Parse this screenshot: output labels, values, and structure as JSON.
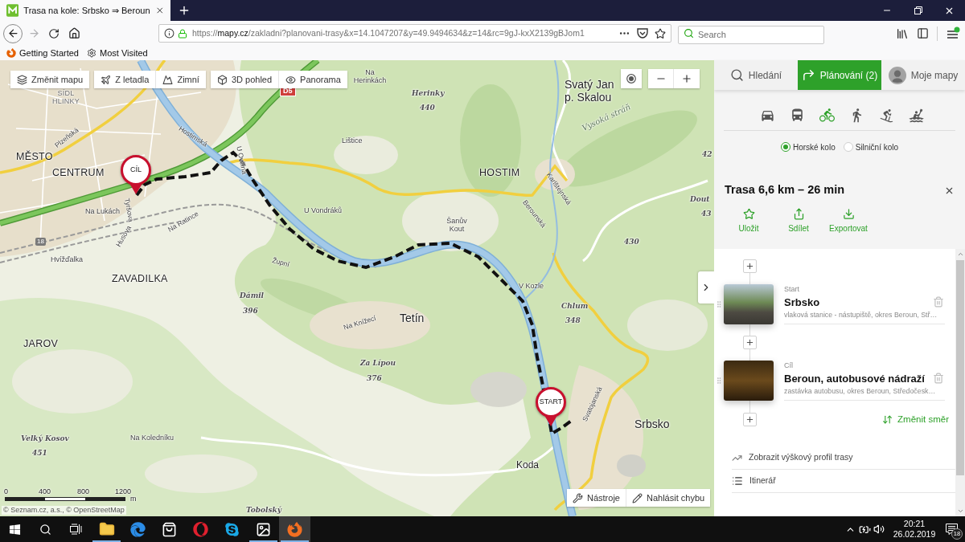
{
  "browser": {
    "tabs": [
      {
        "title": "Trasa na kole: Srbsko ⇒ Beroun",
        "selected": true
      }
    ],
    "address": {
      "scheme": "https://",
      "host": "mapy.cz",
      "path": "/zakladni?planovani-trasy&x=14.1047207&y=49.9494634&z=14&rc=9gJ-kxX2139gBJom1"
    },
    "search": {
      "placeholder": "Search"
    },
    "bookmarks": [
      {
        "label": "Getting Started",
        "kind": "firefox"
      },
      {
        "label": "Most Visited",
        "kind": "gear"
      }
    ]
  },
  "map": {
    "toolbar": [
      {
        "items": [
          {
            "label": "Změnit mapu",
            "kind": "layers"
          }
        ]
      },
      {
        "items": [
          {
            "label": "Z letadla",
            "kind": "plane"
          },
          {
            "label": "Zimní",
            "kind": "mountain"
          }
        ]
      },
      {
        "items": [
          {
            "label": "3D pohled",
            "kind": "cube"
          },
          {
            "label": "Panorama",
            "kind": "eye"
          }
        ]
      }
    ],
    "labels": [
      {
        "text": "Na Herinkách",
        "kind": "locality"
      },
      {
        "text": "SÍDL HLINKY",
        "kind": "district"
      },
      {
        "text": "D5",
        "kind": "highway"
      },
      {
        "text": "Herinky",
        "kind": "hill"
      },
      {
        "text": "Svatý Jan p. Skalou",
        "kind": "town"
      },
      {
        "text": "440",
        "kind": "elevation"
      },
      {
        "text": "Vysoká stráň",
        "kind": "area"
      },
      {
        "text": "Plzeňská",
        "kind": "street"
      },
      {
        "text": "Hostimská",
        "kind": "street"
      },
      {
        "text": "Lištice",
        "kind": "locality"
      },
      {
        "text": "MĚSTO",
        "kind": "city"
      },
      {
        "text": "U Ovčína",
        "kind": "street"
      },
      {
        "text": "42",
        "kind": "elevation"
      },
      {
        "text": "CENTRUM",
        "kind": "city"
      },
      {
        "text": "HOSTIM",
        "kind": "city"
      },
      {
        "text": "Karlštejnská",
        "kind": "street"
      },
      {
        "text": "Dout",
        "kind": "hill"
      },
      {
        "text": "Na Lukách",
        "kind": "locality"
      },
      {
        "text": "Tyršova",
        "kind": "street"
      },
      {
        "text": "Na Ratince",
        "kind": "street"
      },
      {
        "text": "U Vondráků",
        "kind": "locality"
      },
      {
        "text": "Berounská",
        "kind": "street"
      },
      {
        "text": "43",
        "kind": "elevation"
      },
      {
        "text": "Šanův Kout",
        "kind": "locality"
      },
      {
        "text": "18",
        "kind": "railway"
      },
      {
        "text": "Husova",
        "kind": "street"
      },
      {
        "text": "430",
        "kind": "elevation"
      },
      {
        "text": "Hvížďalka",
        "kind": "locality"
      },
      {
        "text": "Župní",
        "kind": "street"
      },
      {
        "text": "ZAVADILKA",
        "kind": "city"
      },
      {
        "text": "V Kozle",
        "kind": "locality"
      },
      {
        "text": "Dámil",
        "kind": "hill"
      },
      {
        "text": "396",
        "kind": "elevation"
      },
      {
        "text": "Chlum",
        "kind": "hill"
      },
      {
        "text": "Na Knížecí",
        "kind": "street"
      },
      {
        "text": "Tetín",
        "kind": "town"
      },
      {
        "text": "348",
        "kind": "elevation"
      },
      {
        "text": "JAROV",
        "kind": "city"
      },
      {
        "text": "Za Lípou",
        "kind": "hill"
      },
      {
        "text": "376",
        "kind": "elevation"
      },
      {
        "text": "Svatojanská",
        "kind": "street"
      },
      {
        "text": "Srbsko",
        "kind": "town"
      },
      {
        "text": "Velký Kosov",
        "kind": "hill"
      },
      {
        "text": "Na Koledníku",
        "kind": "locality"
      },
      {
        "text": "451",
        "kind": "elevation"
      },
      {
        "text": "Koda",
        "kind": "village"
      },
      {
        "text": "Tobolský",
        "kind": "hill"
      }
    ],
    "markers": [
      {
        "label": "CÍL",
        "kind": "end"
      },
      {
        "label": "START",
        "kind": "start"
      }
    ],
    "scale": {
      "ticks": [
        "0",
        "400",
        "800",
        "1200"
      ],
      "unit": "m"
    },
    "attribution": "© Seznam.cz, a.s., © OpenStreetMap",
    "tools": [
      {
        "label": "Nástroje",
        "kind": "tools"
      },
      {
        "label": "Nahlásit chybu",
        "kind": "report"
      }
    ]
  },
  "panel": {
    "tabs": [
      {
        "label": "Hledání",
        "kind": "search",
        "selected": false
      },
      {
        "label": "Plánování (2)",
        "kind": "planning",
        "selected": true
      },
      {
        "label": "Moje mapy",
        "kind": "account",
        "selected": false
      }
    ],
    "transport": [
      {
        "kind": "car",
        "selected": false
      },
      {
        "kind": "bus",
        "selected": false
      },
      {
        "kind": "bike",
        "selected": true
      },
      {
        "kind": "walk",
        "selected": false
      },
      {
        "kind": "ski",
        "selected": false
      },
      {
        "kind": "boat",
        "selected": false
      }
    ],
    "bike_types": [
      {
        "label": "Horské kolo",
        "selected": true
      },
      {
        "label": "Silniční kolo",
        "selected": false
      }
    ],
    "route_title": "Trasa 6,6 km – 26 min",
    "actions": [
      {
        "label": "Uložit",
        "kind": "save"
      },
      {
        "label": "Sdílet",
        "kind": "share"
      },
      {
        "label": "Exportovat",
        "kind": "export"
      }
    ],
    "waypoints": [
      {
        "role": "Start",
        "name": "Srbsko",
        "description": "vlaková stanice - nástupiště, okres Beroun, Stř…"
      },
      {
        "role": "Cíl",
        "name": "Beroun, autobusové nádraží",
        "description": "zastávka autobusu, okres Beroun, Středočesk…"
      }
    ],
    "reverse": "Změnit směr",
    "links": [
      {
        "label": "Zobrazit výškový profil trasy",
        "kind": "profile"
      },
      {
        "label": "Itinerář",
        "kind": "itinerary"
      }
    ]
  },
  "taskbar": {
    "apps": [
      {
        "kind": "explorer",
        "running": true,
        "selected": false
      },
      {
        "kind": "edge",
        "running": false,
        "selected": false
      },
      {
        "kind": "store",
        "running": false,
        "selected": false
      },
      {
        "kind": "opera",
        "running": false,
        "selected": false
      },
      {
        "kind": "skype",
        "running": false,
        "selected": false
      },
      {
        "kind": "photos",
        "running": true,
        "selected": false
      },
      {
        "kind": "firefox",
        "running": true,
        "selected": true
      }
    ],
    "time": "20:21",
    "date": "26.02.2019",
    "notification_count": "18"
  }
}
